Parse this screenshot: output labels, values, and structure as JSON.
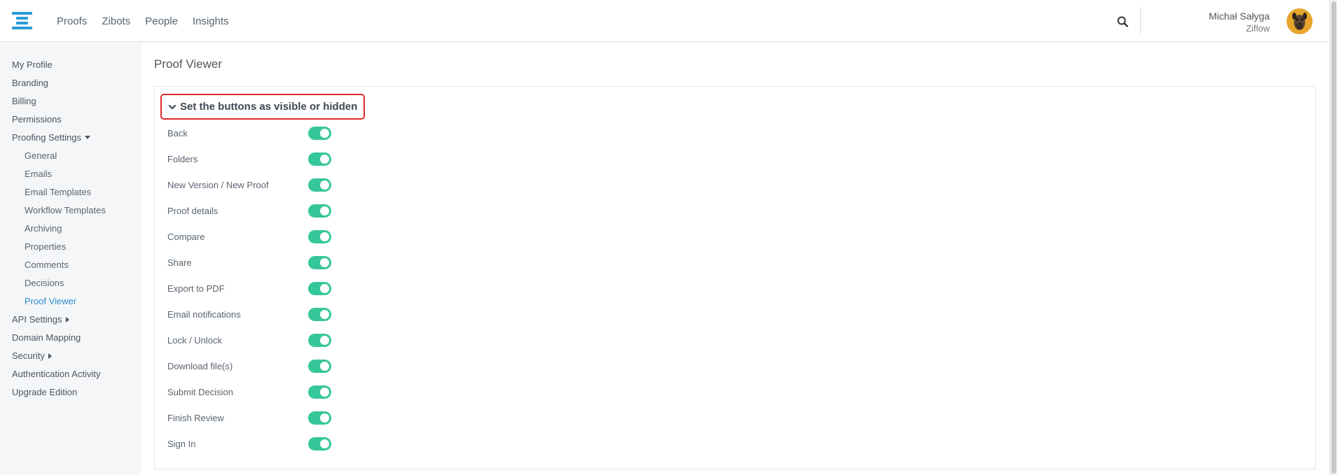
{
  "nav": {
    "items": [
      "Proofs",
      "Zibots",
      "People",
      "Insights"
    ]
  },
  "header": {
    "search_icon": "search-icon",
    "user_name": "Michał Sałyga",
    "user_org": "Ziflow"
  },
  "sidebar": {
    "items": [
      {
        "label": "My Profile"
      },
      {
        "label": "Branding"
      },
      {
        "label": "Billing"
      },
      {
        "label": "Permissions"
      },
      {
        "label": "Proofing Settings"
      },
      {
        "label": "General"
      },
      {
        "label": "Emails"
      },
      {
        "label": "Email Templates"
      },
      {
        "label": "Workflow Templates"
      },
      {
        "label": "Archiving"
      },
      {
        "label": "Properties"
      },
      {
        "label": "Comments"
      },
      {
        "label": "Decisions"
      },
      {
        "label": "Proof Viewer"
      },
      {
        "label": "API Settings"
      },
      {
        "label": "Domain Mapping"
      },
      {
        "label": "Security"
      },
      {
        "label": "Authentication Activity"
      },
      {
        "label": "Upgrade Edition"
      }
    ]
  },
  "main": {
    "title": "Proof Viewer",
    "section_label": "Set the buttons as visible or hidden",
    "accent_color": "#35c79a",
    "buttons": [
      {
        "label": "Back",
        "visible": true
      },
      {
        "label": "Folders",
        "visible": true
      },
      {
        "label": "New Version / New Proof",
        "visible": true
      },
      {
        "label": "Proof details",
        "visible": true
      },
      {
        "label": "Compare",
        "visible": true
      },
      {
        "label": "Share",
        "visible": true
      },
      {
        "label": "Export to PDF",
        "visible": true
      },
      {
        "label": "Email notifications",
        "visible": true
      },
      {
        "label": "Lock / Unlock",
        "visible": true
      },
      {
        "label": "Download file(s)",
        "visible": true
      },
      {
        "label": "Submit Decision",
        "visible": true
      },
      {
        "label": "Finish Review",
        "visible": true
      },
      {
        "label": "Sign In",
        "visible": true
      }
    ]
  }
}
